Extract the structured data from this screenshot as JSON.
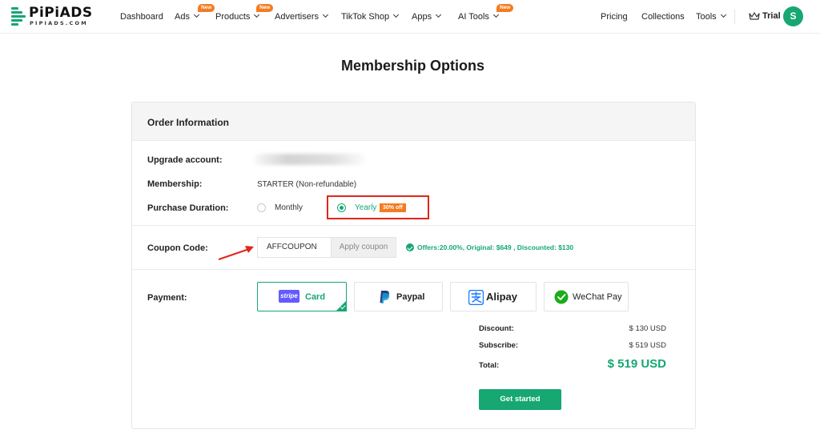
{
  "brand": {
    "name": "PiPiADS",
    "domain": "PIPIADS.COM",
    "accent": "#16a772",
    "badge_color": "#f47b20"
  },
  "nav": {
    "items": [
      {
        "label": "Dashboard"
      },
      {
        "label": "Ads",
        "badge": "New"
      },
      {
        "label": "Products",
        "badge": "New"
      },
      {
        "label": "Advertisers"
      },
      {
        "label": "TikTok Shop"
      },
      {
        "label": "Apps"
      },
      {
        "label": "AI Tools",
        "badge": "New"
      }
    ],
    "right": [
      {
        "label": "Pricing"
      },
      {
        "label": "Collections"
      },
      {
        "label": "Tools"
      }
    ],
    "plan": "Trial",
    "avatar_initial": "S"
  },
  "page": {
    "title": "Membership Options"
  },
  "order": {
    "header": "Order Information",
    "upgrade_account_label": "Upgrade account:",
    "membership_label": "Membership:",
    "membership_value": "STARTER (Non-refundable)",
    "duration_label": "Purchase Duration:",
    "duration_options": [
      {
        "label": "Monthly",
        "selected": false
      },
      {
        "label": "Yearly",
        "selected": true,
        "badge": "30% off"
      }
    ],
    "coupon_label": "Coupon Code:",
    "coupon_value": "AFFCOUPON",
    "apply_label": "Apply coupon",
    "coupon_message": "Offers:20.00%, Original: $649 , Discounted: $130",
    "payment_label": "Payment:",
    "payment_methods": [
      {
        "label": "Card",
        "badge": "stripe",
        "selected": true,
        "icon": "stripe-icon"
      },
      {
        "label": "Paypal",
        "selected": false,
        "icon": "paypal-icon"
      },
      {
        "label": "Alipay",
        "selected": false,
        "icon": "alipay-icon"
      },
      {
        "label": "WeChat Pay",
        "selected": false,
        "icon": "wechat-icon"
      }
    ],
    "summary": {
      "discount_label": "Discount:",
      "discount_value": "$ 130 USD",
      "subscribe_label": "Subscribe:",
      "subscribe_value": "$ 519 USD",
      "total_label": "Total:",
      "total_value": "$ 519 USD"
    },
    "cta_label": "Get started"
  }
}
